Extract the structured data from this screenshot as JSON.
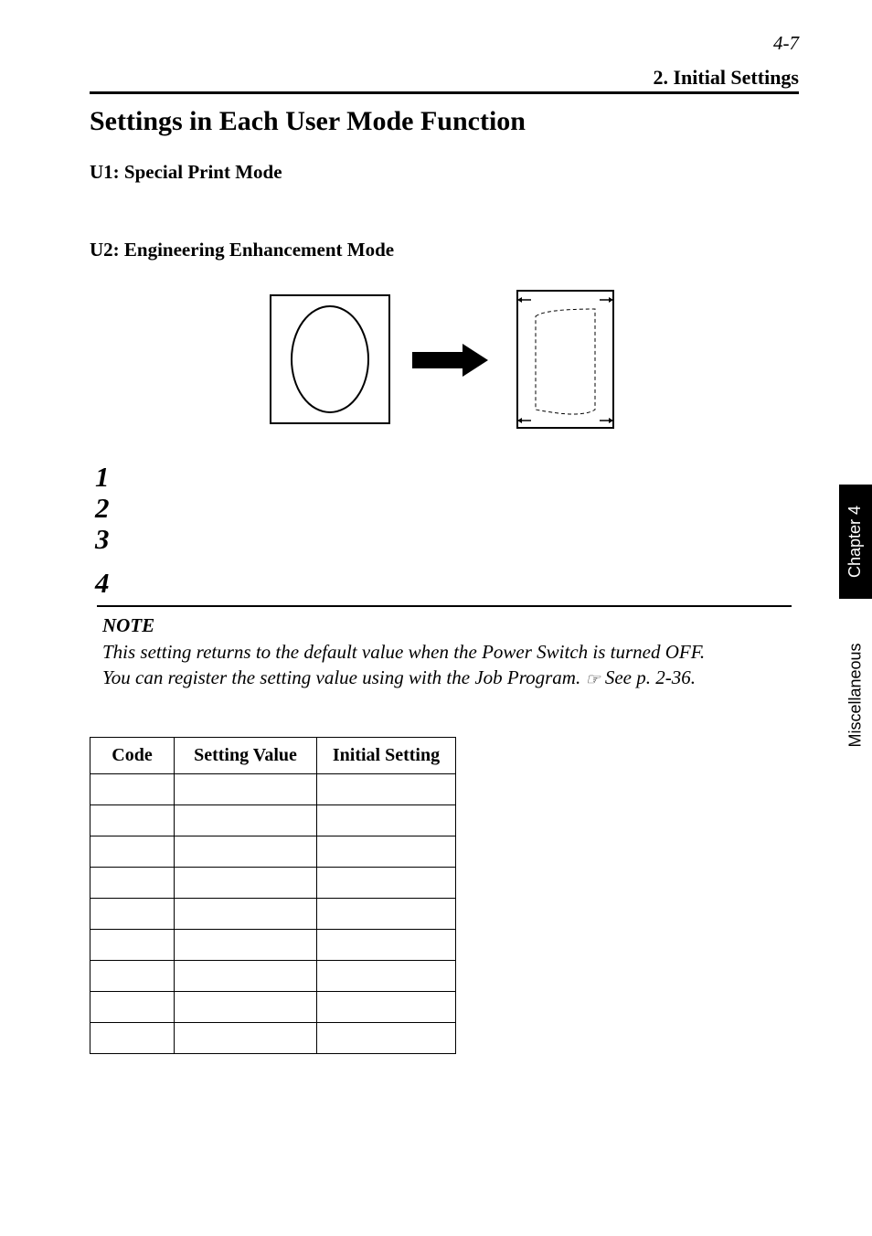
{
  "header": {
    "page_number": "4-7",
    "section_label": "2. Initial Settings"
  },
  "content": {
    "title": "Settings in Each User Mode Function",
    "subhead_u1": "U1: Special Print Mode",
    "subhead_u2": "U2: Engineering Enhancement Mode",
    "steps": [
      "1",
      "2",
      "3",
      "4"
    ],
    "note_title": "NOTE",
    "note_line1": "This setting returns to the default value when the Power Switch is turned OFF.",
    "note_line2_pre": "You can register the setting value using with the Job Program. ",
    "note_line2_ref": "See p. 2-36.",
    "table": {
      "headers": {
        "code": "Code",
        "setting": "Setting Value",
        "initial": "Initial Setting"
      },
      "row_count": 9
    }
  },
  "side_tab": {
    "upper": "Chapter 4",
    "lower": "Miscellaneous"
  },
  "diagram": {
    "description": "paper-shape before/after with arrow",
    "arrow_label": "",
    "icons": [
      "circle-shape",
      "arrow-right",
      "rectangle-dashed-adjust"
    ]
  }
}
